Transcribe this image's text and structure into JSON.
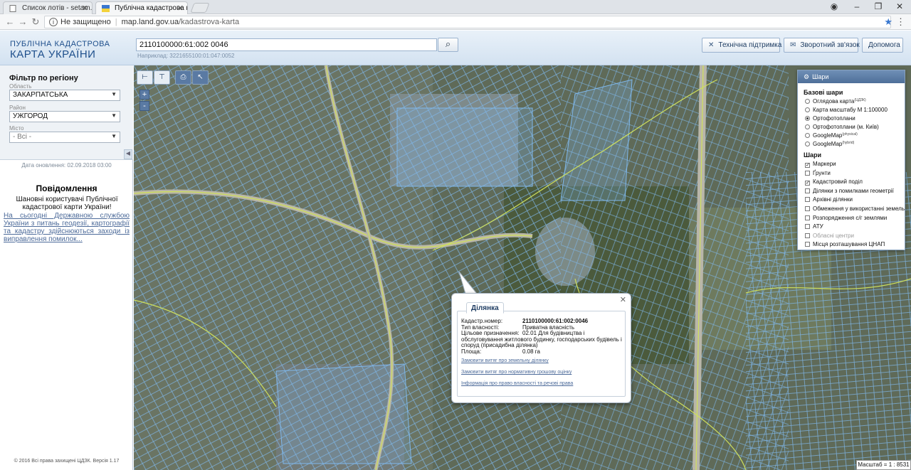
{
  "browser": {
    "tabs": [
      {
        "title": "Список лотів - setam.net",
        "active": false
      },
      {
        "title": "Публічна кадастрова карта",
        "active": true
      }
    ],
    "url": {
      "security": "Не защищено",
      "host": "map.land.gov.ua",
      "path": "/kadastrova-karta"
    }
  },
  "header": {
    "brand_line1": "ПУБЛІЧНА КАДАСТРОВА",
    "brand_line2": "КАРТА УКРАЇНИ",
    "search_value": "2110100000:61:002 0046",
    "search_hint": "Наприклад: 3221655100:01:047:0052",
    "buttons": [
      "Технічна підтримка",
      "Зворотний зв'язок",
      "Допомога"
    ]
  },
  "sidebar": {
    "filter_title": "Фільтр по регіону",
    "region_label": "Область",
    "region_value": "ЗАКАРПАТСЬКА",
    "district_label": "Район",
    "district_value": "УЖГОРОД",
    "city_label": "Місто",
    "city_value": "- Всі -",
    "updated": "Дата оновлення: 02.09.2018 03:00",
    "notice_title": "Повідомлення",
    "notice_text": "Шановні користувачі Публічної кадастрової карти України!",
    "notice_link": "На сьогодні Державною службою України з питань геодезії, картографії та кадастру здійснюються заходи із виправлення помилок...",
    "copyright": "© 2016 Всі права захищені ЦДЗК. Версія 1.17"
  },
  "layers": {
    "title": "Шари",
    "base_title": "Базові шари",
    "base": [
      {
        "label": "Оглядова карта",
        "sup": "(ЦДЗК)",
        "checked": false
      },
      {
        "label": "Карта масштабу М 1:100000",
        "sup": "",
        "checked": false
      },
      {
        "label": "Ортофотоплани",
        "sup": "",
        "checked": true
      },
      {
        "label": "Ортофотоплани (м. Київ)",
        "sup": "",
        "checked": false
      },
      {
        "label": "GoogleMap",
        "sup": "(physical)",
        "checked": false
      },
      {
        "label": "GoogleMap",
        "sup": "(hybrid)",
        "checked": false
      }
    ],
    "overlay_title": "Шари",
    "overlays": [
      {
        "label": "Маркери",
        "checked": true,
        "dim": false
      },
      {
        "label": "Ґрунти",
        "checked": false,
        "dim": false
      },
      {
        "label": "Кадастровий поділ",
        "checked": true,
        "dim": false
      },
      {
        "label": "Ділянки з помилками геометрії",
        "checked": false,
        "dim": false
      },
      {
        "label": "Архівні ділянки",
        "checked": false,
        "dim": false
      },
      {
        "label": "Обмеження у використанні земель",
        "checked": false,
        "dim": false
      },
      {
        "label": "Розпорядження с/г землями",
        "checked": false,
        "dim": false
      },
      {
        "label": "АТУ",
        "checked": false,
        "dim": false
      },
      {
        "label": "Обласні центри",
        "checked": false,
        "dim": true
      },
      {
        "label": "Місця розташування ЦНАП",
        "checked": false,
        "dim": false
      }
    ]
  },
  "popup": {
    "tab": "Ділянка",
    "rows": [
      {
        "k": "Кадастр.номер:",
        "v": "2110100000:61:002:0046",
        "bold": true
      },
      {
        "k": "Тип власності:",
        "v": "Приватна власність",
        "bold": false
      },
      {
        "k": "Цільове призначення:",
        "v": "02.01 Для будівництва і",
        "bold": false
      },
      {
        "k": "",
        "v": "обслуговування житлового будинку, господарських будівель і",
        "bold": false
      },
      {
        "k": "",
        "v": "споруд (присадибна ділянка)",
        "bold": false
      },
      {
        "k": "Площа:",
        "v": "0.08 га",
        "bold": false
      }
    ],
    "links": [
      "Замовити витяг про земельну ділянку",
      "Замовити витяг про нормативну грошову оцінку",
      "Інформація про право власності та речові права"
    ]
  },
  "map": {
    "scale_text": "Масштаб = 1 : 8531",
    "zoom_in": "+",
    "zoom_out": "-",
    "colors": {
      "parcel": "#7fb8ec",
      "boundary": "#b8d84a",
      "water": "#7c8a86"
    }
  }
}
